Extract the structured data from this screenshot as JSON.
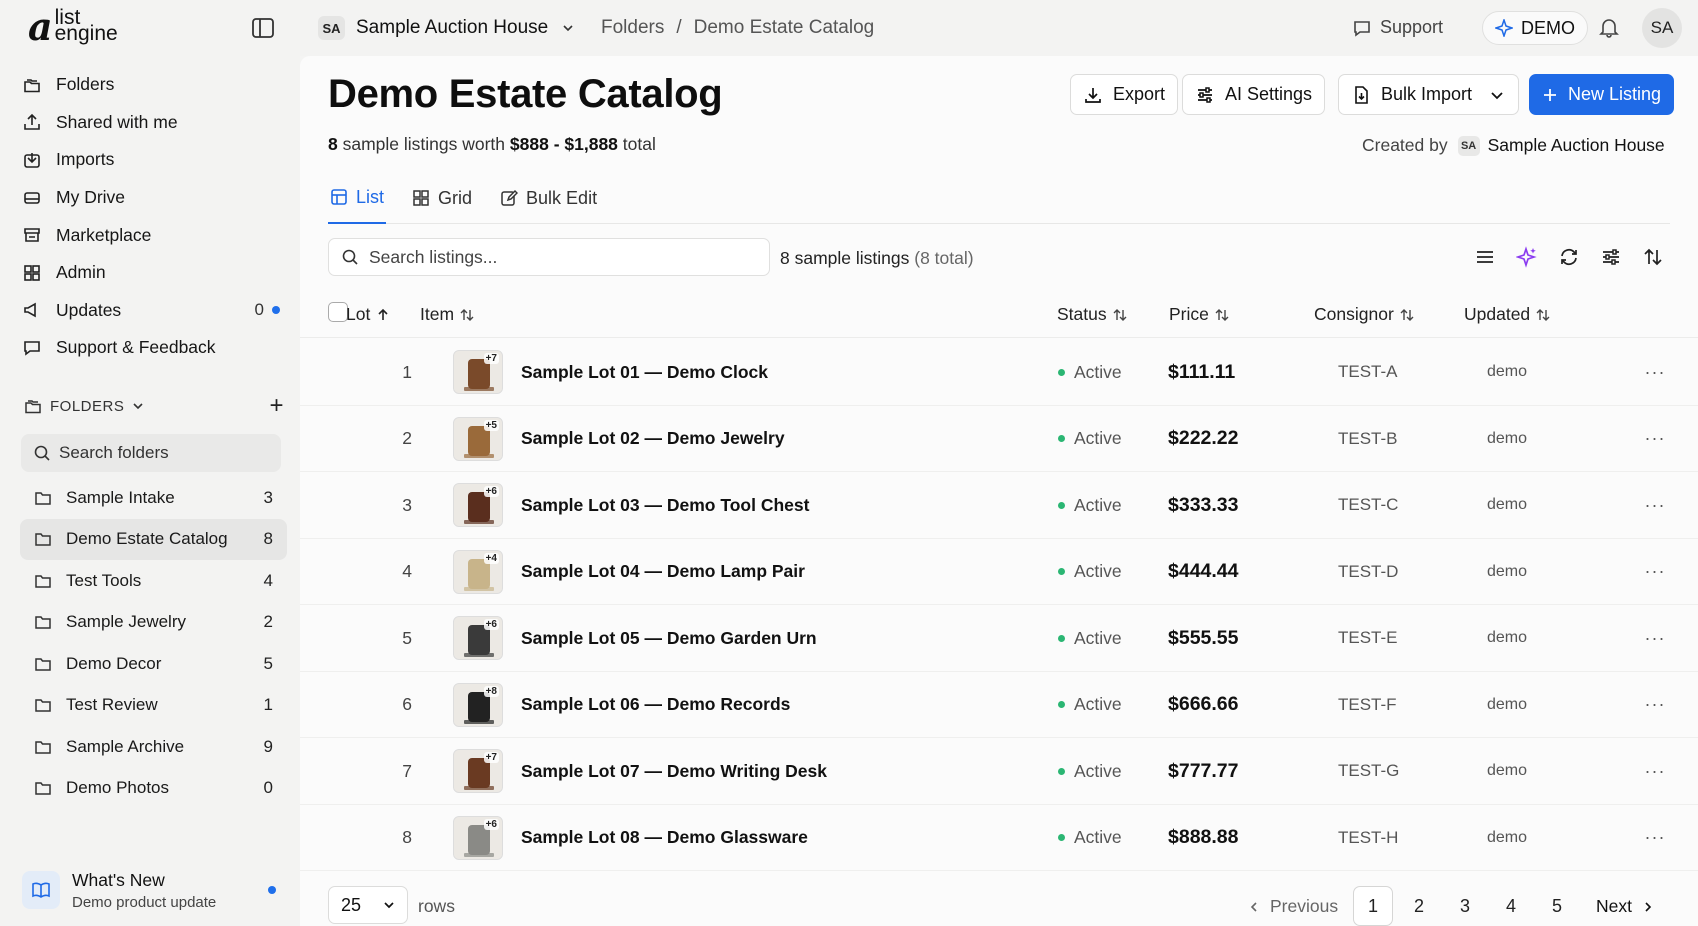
{
  "app": {
    "logo_mark": "a",
    "logo_line1": "list",
    "logo_line2": "engine"
  },
  "sidebar": {
    "nav": [
      {
        "label": "Folders",
        "icon": "folder-stack-icon"
      },
      {
        "label": "Shared with me",
        "icon": "share-icon"
      },
      {
        "label": "Imports",
        "icon": "import-icon"
      },
      {
        "label": "My Drive",
        "icon": "drive-icon"
      },
      {
        "label": "Marketplace",
        "icon": "store-icon"
      },
      {
        "label": "Admin",
        "icon": "grid-icon"
      },
      {
        "label": "Updates",
        "icon": "megaphone-icon",
        "count": "0"
      },
      {
        "label": "Support & Feedback",
        "icon": "chat-icon"
      }
    ],
    "folders_heading": "FOLDERS",
    "folder_search_placeholder": "Search folders",
    "folders": [
      {
        "label": "Sample Intake",
        "count": "3"
      },
      {
        "label": "Demo Estate Catalog",
        "count": "8",
        "active": true
      },
      {
        "label": "Test Tools",
        "count": "4"
      },
      {
        "label": "Sample Jewelry",
        "count": "2"
      },
      {
        "label": "Demo Decor",
        "count": "5"
      },
      {
        "label": "Test Review",
        "count": "1"
      },
      {
        "label": "Sample Archive",
        "count": "9"
      },
      {
        "label": "Demo Photos",
        "count": "0"
      }
    ],
    "whats_new": {
      "title": "What's New",
      "subtitle": "Demo product update"
    }
  },
  "topbar": {
    "org_initials": "SA",
    "org_name": "Sample Auction House",
    "breadcrumb": [
      "Folders",
      "/",
      "Demo Estate Catalog"
    ],
    "support_label": "Support",
    "demo_label": "DEMO",
    "avatar_initials": "SA"
  },
  "header": {
    "title": "Demo Estate Catalog",
    "summary_count": "8",
    "summary_text1": "sample listings worth",
    "summary_range": "$888 - $1,888",
    "summary_text2": "total",
    "created_by_label": "Created by",
    "created_by_initials": "SA",
    "created_by_name": "Sample Auction House",
    "buttons": {
      "export": "Export",
      "ai_settings": "AI Settings",
      "bulk_import": "Bulk Import",
      "new_listing": "New Listing"
    }
  },
  "tabs": [
    {
      "label": "List",
      "active": true
    },
    {
      "label": "Grid"
    },
    {
      "label": "Bulk Edit"
    }
  ],
  "toolbar": {
    "search_placeholder": "Search listings...",
    "count_text": "8 sample listings",
    "total_text": "(8 total)"
  },
  "table": {
    "columns": {
      "lot": "Lot",
      "item": "Item",
      "status": "Status",
      "price": "Price",
      "consignor": "Consignor",
      "updated": "Updated"
    },
    "rows": [
      {
        "lot": "1",
        "photos": "+7",
        "item": "Sample Lot 01 — Demo Clock",
        "status": "Active",
        "price": "$111.11",
        "consignor": "TEST-A",
        "updated": "demo",
        "thumb_color": "#7a4a2a"
      },
      {
        "lot": "2",
        "photos": "+5",
        "item": "Sample Lot 02 — Demo Jewelry",
        "status": "Active",
        "price": "$222.22",
        "consignor": "TEST-B",
        "updated": "demo",
        "thumb_color": "#9a6a3a"
      },
      {
        "lot": "3",
        "photos": "+6",
        "item": "Sample Lot 03 — Demo Tool Chest",
        "status": "Active",
        "price": "$333.33",
        "consignor": "TEST-C",
        "updated": "demo",
        "thumb_color": "#5a2e1e"
      },
      {
        "lot": "4",
        "photos": "+4",
        "item": "Sample Lot 04 — Demo Lamp Pair",
        "status": "Active",
        "price": "$444.44",
        "consignor": "TEST-D",
        "updated": "demo",
        "thumb_color": "#c8b48a"
      },
      {
        "lot": "5",
        "photos": "+6",
        "item": "Sample Lot 05 — Demo Garden Urn",
        "status": "Active",
        "price": "$555.55",
        "consignor": "TEST-E",
        "updated": "demo",
        "thumb_color": "#3a3a3a"
      },
      {
        "lot": "6",
        "photos": "+8",
        "item": "Sample Lot 06 — Demo Records",
        "status": "Active",
        "price": "$666.66",
        "consignor": "TEST-F",
        "updated": "demo",
        "thumb_color": "#222222"
      },
      {
        "lot": "7",
        "photos": "+7",
        "item": "Sample Lot 07 — Demo Writing Desk",
        "status": "Active",
        "price": "$777.77",
        "consignor": "TEST-G",
        "updated": "demo",
        "thumb_color": "#6a3a22"
      },
      {
        "lot": "8",
        "photos": "+6",
        "item": "Sample Lot 08 — Demo Glassware",
        "status": "Active",
        "price": "$888.88",
        "consignor": "TEST-H",
        "updated": "demo",
        "thumb_color": "#8a8a86"
      }
    ]
  },
  "pager": {
    "per_page": "25",
    "rows_label": "rows",
    "previous": "Previous",
    "next": "Next",
    "pages": [
      "1",
      "2",
      "3",
      "4",
      "5"
    ],
    "current": "1"
  },
  "colors": {
    "accent": "#1f6ae6",
    "status_active": "#2bb673",
    "notification_dot": "#1f6feb"
  }
}
